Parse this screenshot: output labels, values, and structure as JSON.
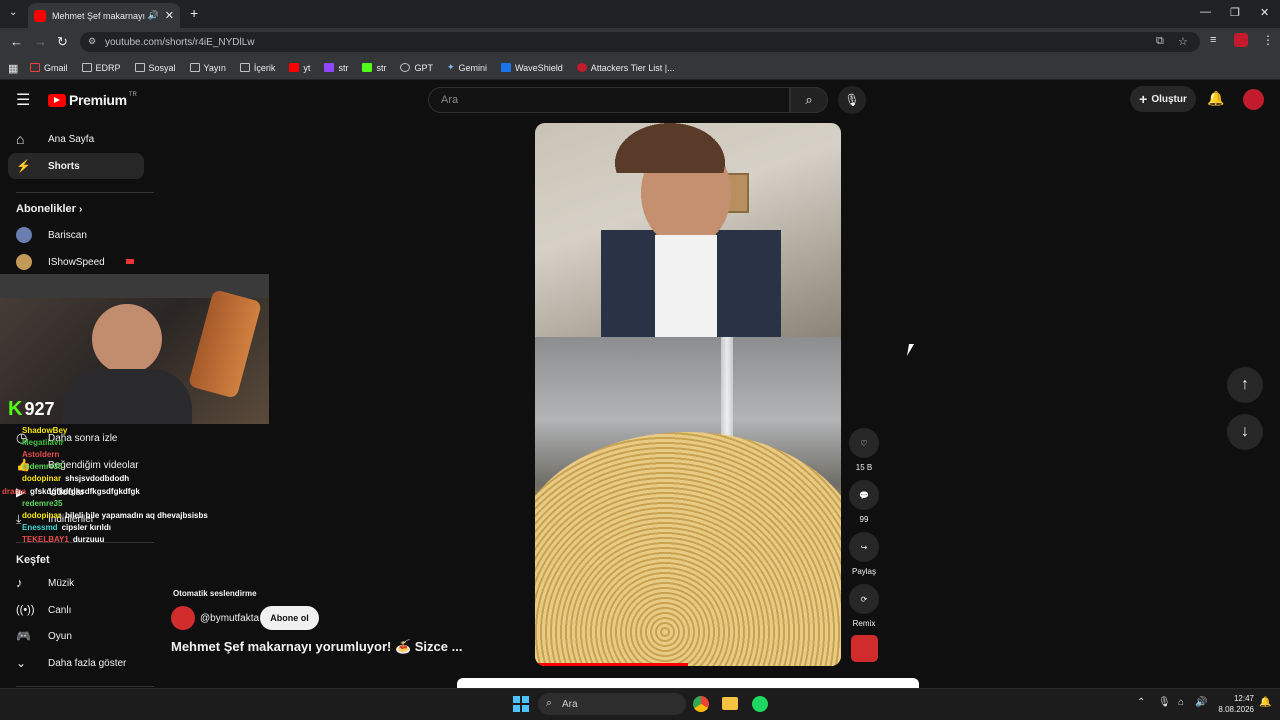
{
  "browser": {
    "tab_title": "Mehmet Şef makarnayı yor",
    "url": "youtube.com/shorts/r4iE_NYDlLw",
    "bookmarks": [
      "Gmail",
      "EDRP",
      "Sosyal",
      "Yayın",
      "İçerik",
      "yt",
      "str",
      "str",
      "GPT",
      "Gemini",
      "WaveShield",
      "Attackers Tier List |..."
    ]
  },
  "youtube": {
    "logo_text": "Premium",
    "logo_region": "TR",
    "search_placeholder": "Ara",
    "create_label": "Oluştur",
    "sidebar": {
      "home": "Ana Sayfa",
      "shorts": "Shorts",
      "subscriptions_header": "Abonelikler",
      "subs": [
        "Bariscan",
        "IShowSpeed"
      ],
      "watch_later": "Daha sonra izle",
      "liked": "Beğendiğim videolar",
      "videos": "Videolar",
      "downloads": "İndirilenler",
      "explore_header": "Keşfet",
      "music": "Müzik",
      "live": "Canlı",
      "gaming": "Oyun",
      "show_more": "Daha fazla göster"
    },
    "short": {
      "auto_dub": "Otomatik seslendirme",
      "channel": "@bymutfakta",
      "subscribe": "Abone ol",
      "title": "Mehmet Şef makarnayı yorumluyor! 🍝 Sizce ...",
      "likes": "15 B",
      "comments": "99",
      "share": "Paylaş",
      "remix": "Remix"
    }
  },
  "overlay": {
    "kick_count": "927",
    "chat": [
      {
        "user": "ShadowBey",
        "msg": "",
        "color": "#f5e60a"
      },
      {
        "user": "Megatilavir",
        "msg": "",
        "color": "#3dbf3d"
      },
      {
        "user": "Astoldern",
        "msg": "",
        "color": "#e84a4a"
      },
      {
        "user": "redemre35",
        "msg": "",
        "color": "#5bd65b"
      },
      {
        "user": "dodopinar",
        "msg": "shsjsvdodbdodh",
        "color": "#f5e60a"
      },
      {
        "user": "drama",
        "msg": "gfskdgfkdfgksdfkgsdfgkdfgk",
        "color": "#e84a4a"
      },
      {
        "user": "redemre35",
        "msg": "",
        "color": "#5bd65b"
      },
      {
        "user": "dodopinar",
        "msg": "bileli bile yapamadın aq dhevajbsisbs",
        "color": "#f5e60a"
      },
      {
        "user": "Enessmd",
        "msg": "cipsler kırıldı",
        "color": "#3dd6d6"
      },
      {
        "user": "TEKELBAY1",
        "msg": "durzuuu",
        "color": "#e84a4a"
      }
    ]
  },
  "taskbar": {
    "search_placeholder": "Ara",
    "time": "12:47",
    "date": "8.08.2026"
  }
}
